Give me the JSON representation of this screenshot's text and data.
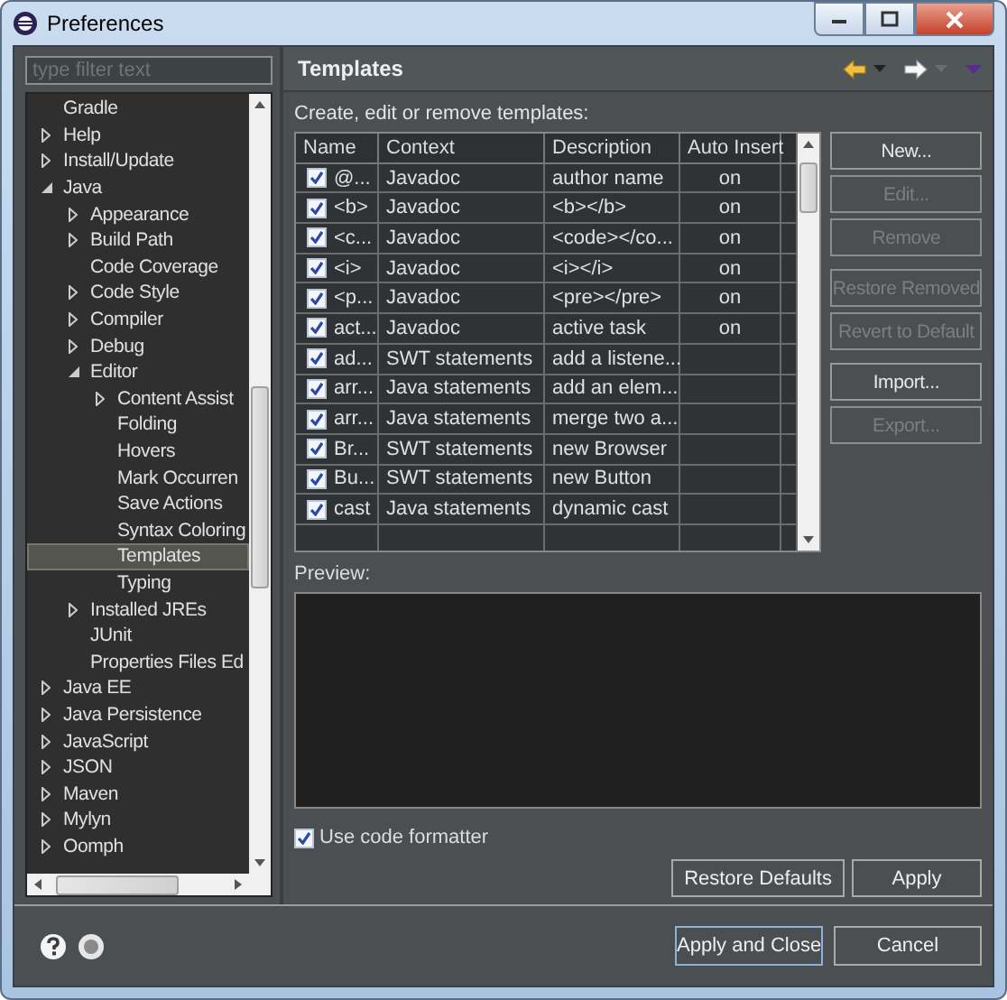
{
  "window": {
    "title": "Preferences"
  },
  "filter": {
    "placeholder": "type filter text"
  },
  "tree": [
    {
      "label": "Gradle",
      "kind": "leaf",
      "selected": false
    },
    {
      "label": "Help",
      "kind": "node",
      "expanded": false,
      "selected": false
    },
    {
      "label": "Install/Update",
      "kind": "node",
      "expanded": false,
      "selected": false
    },
    {
      "label": "Java",
      "kind": "node",
      "expanded": true,
      "selected": false,
      "children": [
        {
          "label": "Appearance",
          "kind": "node",
          "expanded": false,
          "selected": false
        },
        {
          "label": "Build Path",
          "kind": "node",
          "expanded": false,
          "selected": false
        },
        {
          "label": "Code Coverage",
          "kind": "leaf",
          "selected": false
        },
        {
          "label": "Code Style",
          "kind": "node",
          "expanded": false,
          "selected": false
        },
        {
          "label": "Compiler",
          "kind": "node",
          "expanded": false,
          "selected": false
        },
        {
          "label": "Debug",
          "kind": "node",
          "expanded": false,
          "selected": false
        },
        {
          "label": "Editor",
          "kind": "node",
          "expanded": true,
          "selected": false,
          "children": [
            {
              "label": "Content Assist",
              "kind": "node",
              "expanded": false,
              "selected": false
            },
            {
              "label": "Folding",
              "kind": "leaf",
              "selected": false
            },
            {
              "label": "Hovers",
              "kind": "leaf",
              "selected": false
            },
            {
              "label": "Mark Occurren",
              "kind": "leaf",
              "selected": false
            },
            {
              "label": "Save Actions",
              "kind": "leaf",
              "selected": false
            },
            {
              "label": "Syntax Coloring",
              "kind": "leaf",
              "selected": false
            },
            {
              "label": "Templates",
              "kind": "leaf",
              "selected": true
            },
            {
              "label": "Typing",
              "kind": "leaf",
              "selected": false
            }
          ]
        },
        {
          "label": "Installed JREs",
          "kind": "node",
          "expanded": false,
          "selected": false
        },
        {
          "label": "JUnit",
          "kind": "leaf",
          "selected": false
        },
        {
          "label": "Properties Files Ed",
          "kind": "leaf",
          "selected": false
        }
      ]
    },
    {
      "label": "Java EE",
      "kind": "node",
      "expanded": false,
      "selected": false
    },
    {
      "label": "Java Persistence",
      "kind": "node",
      "expanded": false,
      "selected": false
    },
    {
      "label": "JavaScript",
      "kind": "node",
      "expanded": false,
      "selected": false
    },
    {
      "label": "JSON",
      "kind": "node",
      "expanded": false,
      "selected": false
    },
    {
      "label": "Maven",
      "kind": "node",
      "expanded": false,
      "selected": false
    },
    {
      "label": "Mylyn",
      "kind": "node",
      "expanded": false,
      "selected": false
    },
    {
      "label": "Oomph",
      "kind": "node",
      "expanded": false,
      "selected": false
    }
  ],
  "page": {
    "title": "Templates",
    "description": "Create, edit or remove templates:",
    "table": {
      "columns": [
        "Name",
        "Context",
        "Description",
        "Auto Insert"
      ],
      "rows": [
        {
          "checked": true,
          "name": "@...",
          "context": "Javadoc",
          "description": "author name",
          "auto_insert": "on"
        },
        {
          "checked": true,
          "name": "<b>",
          "context": "Javadoc",
          "description": "<b></b>",
          "auto_insert": "on"
        },
        {
          "checked": true,
          "name": "<c...",
          "context": "Javadoc",
          "description": "<code></co...",
          "auto_insert": "on"
        },
        {
          "checked": true,
          "name": "<i>",
          "context": "Javadoc",
          "description": "<i></i>",
          "auto_insert": "on"
        },
        {
          "checked": true,
          "name": "<p...",
          "context": "Javadoc",
          "description": "<pre></pre>",
          "auto_insert": "on"
        },
        {
          "checked": true,
          "name": "act...",
          "context": "Javadoc",
          "description": "active task",
          "auto_insert": "on"
        },
        {
          "checked": true,
          "name": "ad...",
          "context": "SWT statements",
          "description": "add a listene..."
        },
        {
          "checked": true,
          "name": "arr...",
          "context": "Java statements",
          "description": "add an elem..."
        },
        {
          "checked": true,
          "name": "arr...",
          "context": "Java statements",
          "description": "merge two a..."
        },
        {
          "checked": true,
          "name": "Br...",
          "context": "SWT statements",
          "description": "new Browser"
        },
        {
          "checked": true,
          "name": "Bu...",
          "context": "SWT statements",
          "description": "new Button"
        },
        {
          "checked": true,
          "name": "cast",
          "context": "Java statements",
          "description": "dynamic cast"
        }
      ]
    },
    "button_groups": [
      {
        "buttons": [
          {
            "label": "New...",
            "disabled": false
          },
          {
            "label": "Edit...",
            "disabled": true
          },
          {
            "label": "Remove",
            "disabled": true
          }
        ]
      },
      {
        "buttons": [
          {
            "label": "Restore Removed",
            "disabled": true
          },
          {
            "label": "Revert to Default",
            "disabled": true
          }
        ]
      },
      {
        "buttons": [
          {
            "label": "Import...",
            "disabled": false
          },
          {
            "label": "Export...",
            "disabled": true
          }
        ]
      }
    ],
    "preview_label": "Preview:",
    "formatter": {
      "label": "Use code formatter",
      "checked": true
    },
    "page_buttons": [
      {
        "label": "Restore Defaults"
      },
      {
        "label": "Apply"
      }
    ]
  },
  "dialog_buttons": [
    {
      "label": "Apply and Close",
      "default": true
    },
    {
      "label": "Cancel",
      "default": false
    }
  ]
}
